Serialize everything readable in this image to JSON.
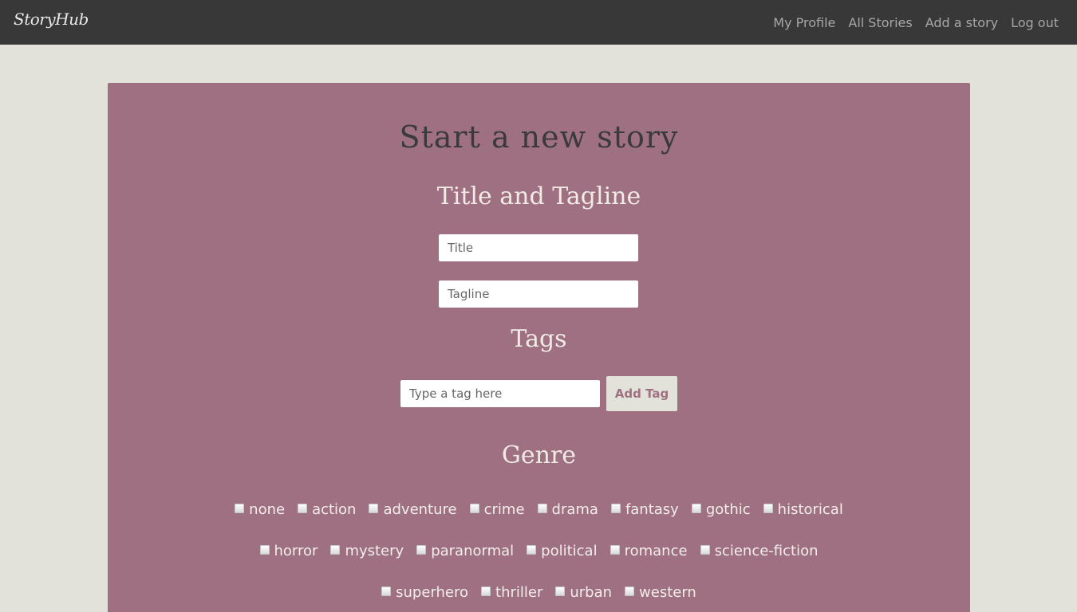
{
  "navbar": {
    "brand": "StoryHub",
    "links": [
      "My Profile",
      "All Stories",
      "Add a story",
      "Log out"
    ]
  },
  "form": {
    "title": "Start a new story",
    "title_section": "Title and Tagline",
    "title_placeholder": "Title",
    "tagline_placeholder": "Tagline",
    "tags_section": "Tags",
    "tag_placeholder": "Type a tag here",
    "add_tag_label": "Add Tag",
    "genre_section": "Genre",
    "genres": [
      "none",
      "action",
      "adventure",
      "crime",
      "drama",
      "fantasy",
      "gothic",
      "historical",
      "horror",
      "mystery",
      "paranormal",
      "political",
      "romance",
      "science-fiction",
      "superhero",
      "thriller",
      "urban",
      "western"
    ]
  },
  "colors": {
    "navbar": "#383838",
    "page_background": "#e2e2da",
    "card": "#9e7081",
    "button_text": "#9e7081"
  }
}
